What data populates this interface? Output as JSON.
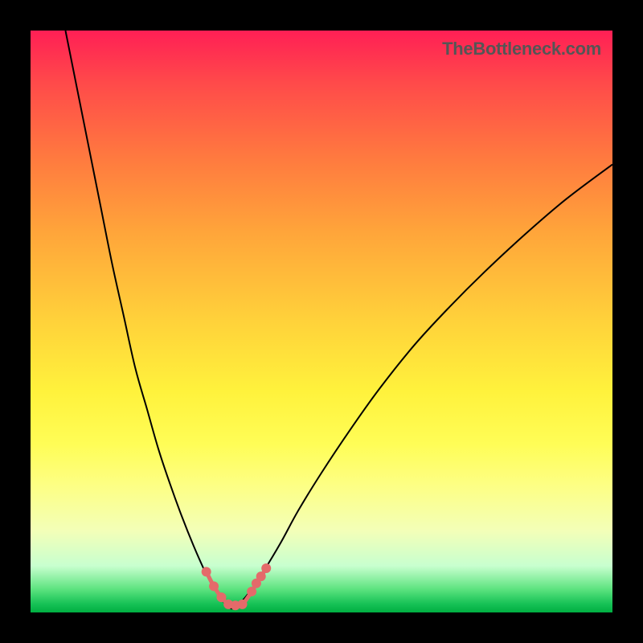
{
  "watermark": "TheBottleneck.com",
  "chart_data": {
    "type": "line",
    "title": "",
    "xlabel": "",
    "ylabel": "",
    "xlim": [
      0,
      100
    ],
    "ylim": [
      0,
      100
    ],
    "grid": false,
    "legend": false,
    "background_gradient": [
      "#ff1f55",
      "#ffd23a",
      "#fffd56",
      "#17c256"
    ],
    "description": "V-shaped bottleneck curve with steep left branch and shallower right branch; minimum (best match) near x≈35. A small cluster of salmon markers sits at the valley floor.",
    "series": [
      {
        "name": "left-branch",
        "x": [
          6,
          8,
          10,
          12,
          14,
          16,
          18,
          20,
          22,
          24,
          26,
          28,
          30,
          31.5,
          33,
          34.5
        ],
        "values": [
          100,
          90,
          80,
          70,
          60,
          51,
          42,
          35,
          28,
          22,
          16.5,
          11.5,
          7,
          4.2,
          2,
          0.6
        ]
      },
      {
        "name": "right-branch",
        "x": [
          34.5,
          36,
          38,
          40,
          43,
          46,
          50,
          55,
          60,
          66,
          72,
          78,
          85,
          92,
          100
        ],
        "values": [
          0.6,
          1.6,
          4,
          7,
          12,
          17.5,
          24,
          31.5,
          38.5,
          46,
          52.5,
          58.5,
          65,
          71,
          77
        ]
      }
    ],
    "markers": {
      "name": "valley-markers",
      "x": [
        30.2,
        31.5,
        32.8,
        34,
        35.2,
        36.4,
        38,
        38.8,
        39.6,
        40.5
      ],
      "y": [
        7,
        4.5,
        2.6,
        1.4,
        1.2,
        1.4,
        3.6,
        5,
        6.2,
        7.6
      ],
      "color": "#e46a6a",
      "radius": 6
    }
  }
}
